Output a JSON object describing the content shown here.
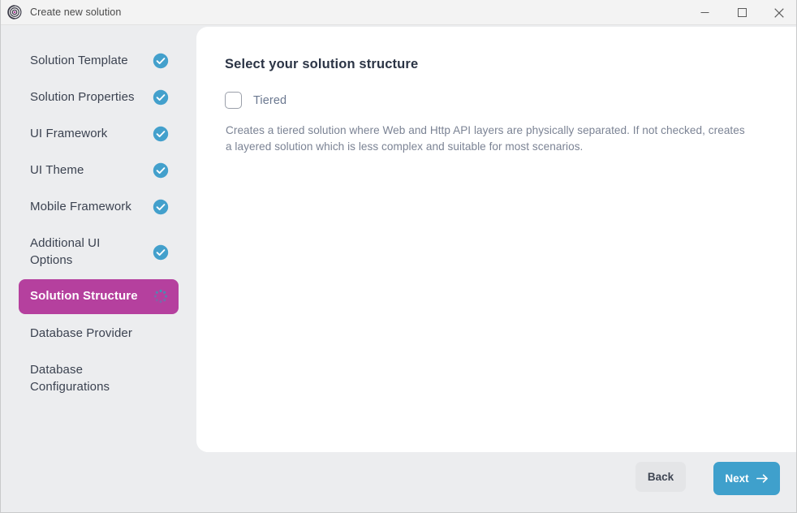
{
  "window": {
    "title": "Create new solution",
    "app_icon": "abp-logo-icon",
    "controls": [
      {
        "name": "minimize-button",
        "icon": "minimize-icon"
      },
      {
        "name": "maximize-button",
        "icon": "maximize-icon"
      },
      {
        "name": "close-button",
        "icon": "close-icon"
      }
    ]
  },
  "colors": {
    "accent_magenta": "#b5409e",
    "accent_blue": "#3fa0cc",
    "sidebar_bg": "#ecedef",
    "panel_bg": "#ffffff",
    "heading_text": "#2b3445",
    "body_text": "#7b8394"
  },
  "sidebar": {
    "items": [
      {
        "label": "Solution Template",
        "status": "complete",
        "icon": "check-circle-icon",
        "active": false
      },
      {
        "label": "Solution Properties",
        "status": "complete",
        "icon": "check-circle-icon",
        "active": false
      },
      {
        "label": "UI Framework",
        "status": "complete",
        "icon": "check-circle-icon",
        "active": false
      },
      {
        "label": "UI Theme",
        "status": "complete",
        "icon": "check-circle-icon",
        "active": false
      },
      {
        "label": "Mobile Framework",
        "status": "complete",
        "icon": "check-circle-icon",
        "active": false
      },
      {
        "label": "Additional UI Options",
        "status": "complete",
        "icon": "check-circle-icon",
        "active": false
      },
      {
        "label": "Solution Structure",
        "status": "loading",
        "icon": "spinner-icon",
        "active": true
      },
      {
        "label": "Database Provider",
        "status": "pending",
        "icon": "none",
        "active": false
      },
      {
        "label": "Database Configurations",
        "status": "pending",
        "icon": "none",
        "active": false
      }
    ]
  },
  "main": {
    "heading": "Select your solution structure",
    "checkbox": {
      "label": "Tiered",
      "checked": false
    },
    "description": "Creates a tiered solution where Web and Http API layers are physically separated. If not checked, creates a layered solution which is less complex and suitable for most scenarios."
  },
  "footer": {
    "back_label": "Back",
    "next_label": "Next",
    "next_icon": "arrow-right-icon"
  }
}
